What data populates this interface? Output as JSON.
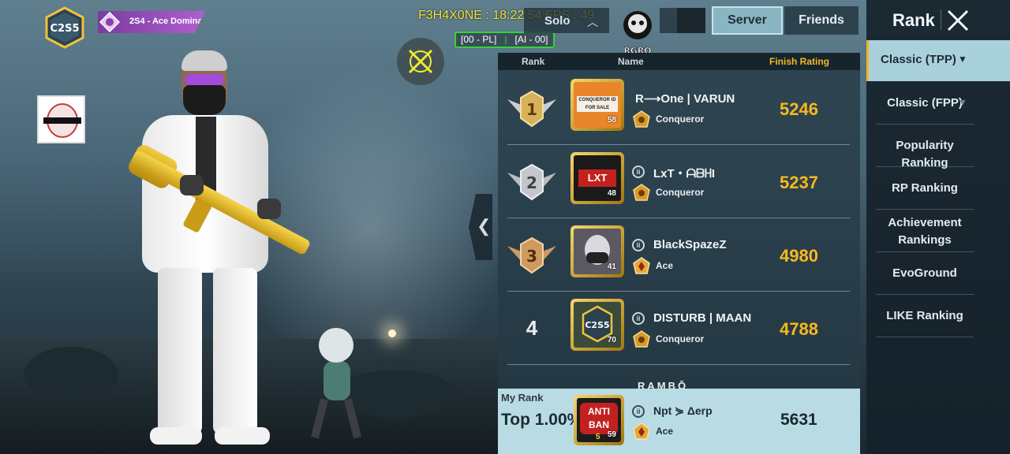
{
  "hud": {
    "clan_logo_text": "C2S5",
    "season_badge": "2S4 - Ace Domina",
    "debug_overlay": "F3H4X0NE : 18:22:54 FPS : 49",
    "ping_left": "[00 - PL]",
    "ping_right": "[AI - 00]"
  },
  "topbar": {
    "mode": "Solo",
    "record_label": "RGRO",
    "tabs": [
      "Server",
      "Friends"
    ],
    "active_tab": "Server"
  },
  "leaderboard": {
    "headers": {
      "rank": "Rank",
      "name": "Name",
      "rating": "Finish Rating"
    },
    "rows": [
      {
        "rank": "1",
        "name": "R⟶One | VARUN",
        "tier": "Conqueror",
        "rating": "5246",
        "level": "58",
        "frame_text": "CONQUEROR ID FOR SALE"
      },
      {
        "rank": "2",
        "name": "LxT・ᗩᗷᕼI",
        "tier": "Conqueror",
        "rating": "5237",
        "level": "48",
        "frame_text": "LXT"
      },
      {
        "rank": "3",
        "name": "BlackSpazeZ",
        "tier": "Ace",
        "rating": "4980",
        "level": "41",
        "frame_text": ""
      },
      {
        "rank": "4",
        "name": "DISTURB | MAAN",
        "tier": "Conqueror",
        "rating": "4788",
        "level": "70",
        "frame_text": "C2S5"
      }
    ],
    "peek_name": "RAMBŌ"
  },
  "my_rank": {
    "label": "My Rank",
    "top": "Top 1.00%",
    "name": "Npt ⋟ Δerp",
    "tier": "Ace",
    "rating": "5631",
    "level": "59",
    "frame_text": "ANTI BAN",
    "frame_num": "5"
  },
  "side_panel": {
    "title": "Rank",
    "items": [
      "Classic (TPP)",
      "Classic (FPP)",
      "Popularity Ranking",
      "RP Ranking",
      "Achievement Rankings",
      "EvoGround",
      "LIKE Ranking"
    ],
    "active_index": 0
  },
  "colors": {
    "accent_gold": "#f7b91e",
    "active_tab": "#8ab6c4",
    "ping_border": "#35d435",
    "debug_text": "#f5e23a"
  }
}
